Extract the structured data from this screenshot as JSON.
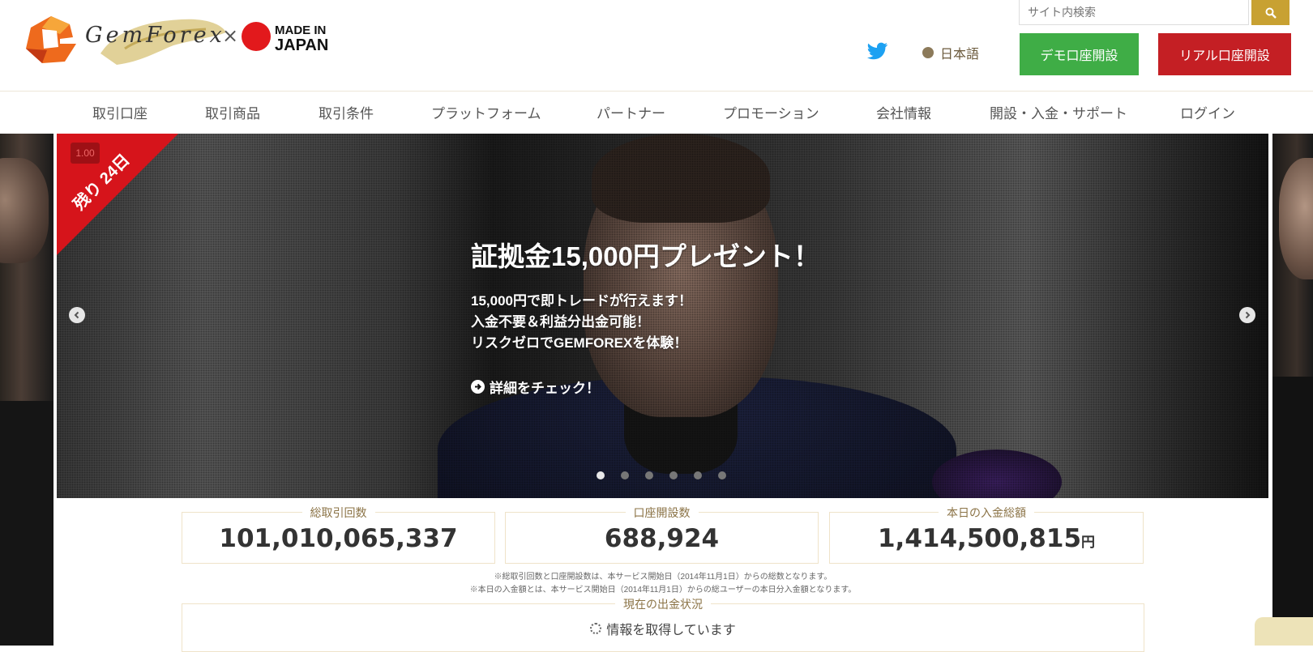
{
  "header": {
    "logo_text": "GemForex",
    "logo_x": "×",
    "made_in": "MADE IN",
    "japan": "JAPAN",
    "search_placeholder": "サイト内検索",
    "language": "日本語",
    "demo_button": "デモ口座開設",
    "real_button": "リアル口座開設"
  },
  "nav": {
    "items": [
      "取引口座",
      "取引商品",
      "取引条件",
      "プラットフォーム",
      "パートナー",
      "プロモーション",
      "会社情報",
      "開設・入金・サポート",
      "ログイン"
    ]
  },
  "slide": {
    "ribbon": "残り 24日",
    "badge": "1.00",
    "title": "証拠金15,000円プレゼント！",
    "lines": [
      "15,000円で即トレードが行えます！",
      "入金不要＆利益分出金可能！",
      "リスクゼロでGEMFOREXを体験！"
    ],
    "cta": "詳細をチェック！",
    "pager_count": 6,
    "active_index": 0
  },
  "stats": [
    {
      "label": "総取引回数",
      "value": "101,010,065,337",
      "unit": ""
    },
    {
      "label": "口座開設数",
      "value": "688,924",
      "unit": ""
    },
    {
      "label": "本日の入金総額",
      "value": "1,414,500,815",
      "unit": "円"
    }
  ],
  "notes": [
    "※総取引回数と口座開設数は、本サービス開始日（2014年11月1日）からの総数となります。",
    "※本日の入金額とは、本サービス開始日（2014年11月1日）からの総ユーザーの本日分入金額となります。"
  ],
  "withdrawal": {
    "title": "現在の出金状況",
    "loading": "情報を取得しています"
  },
  "colors": {
    "gold": "#c8a132",
    "demo_green": "#3fad46",
    "real_red": "#c41f24",
    "ribbon_red": "#d6141b"
  }
}
